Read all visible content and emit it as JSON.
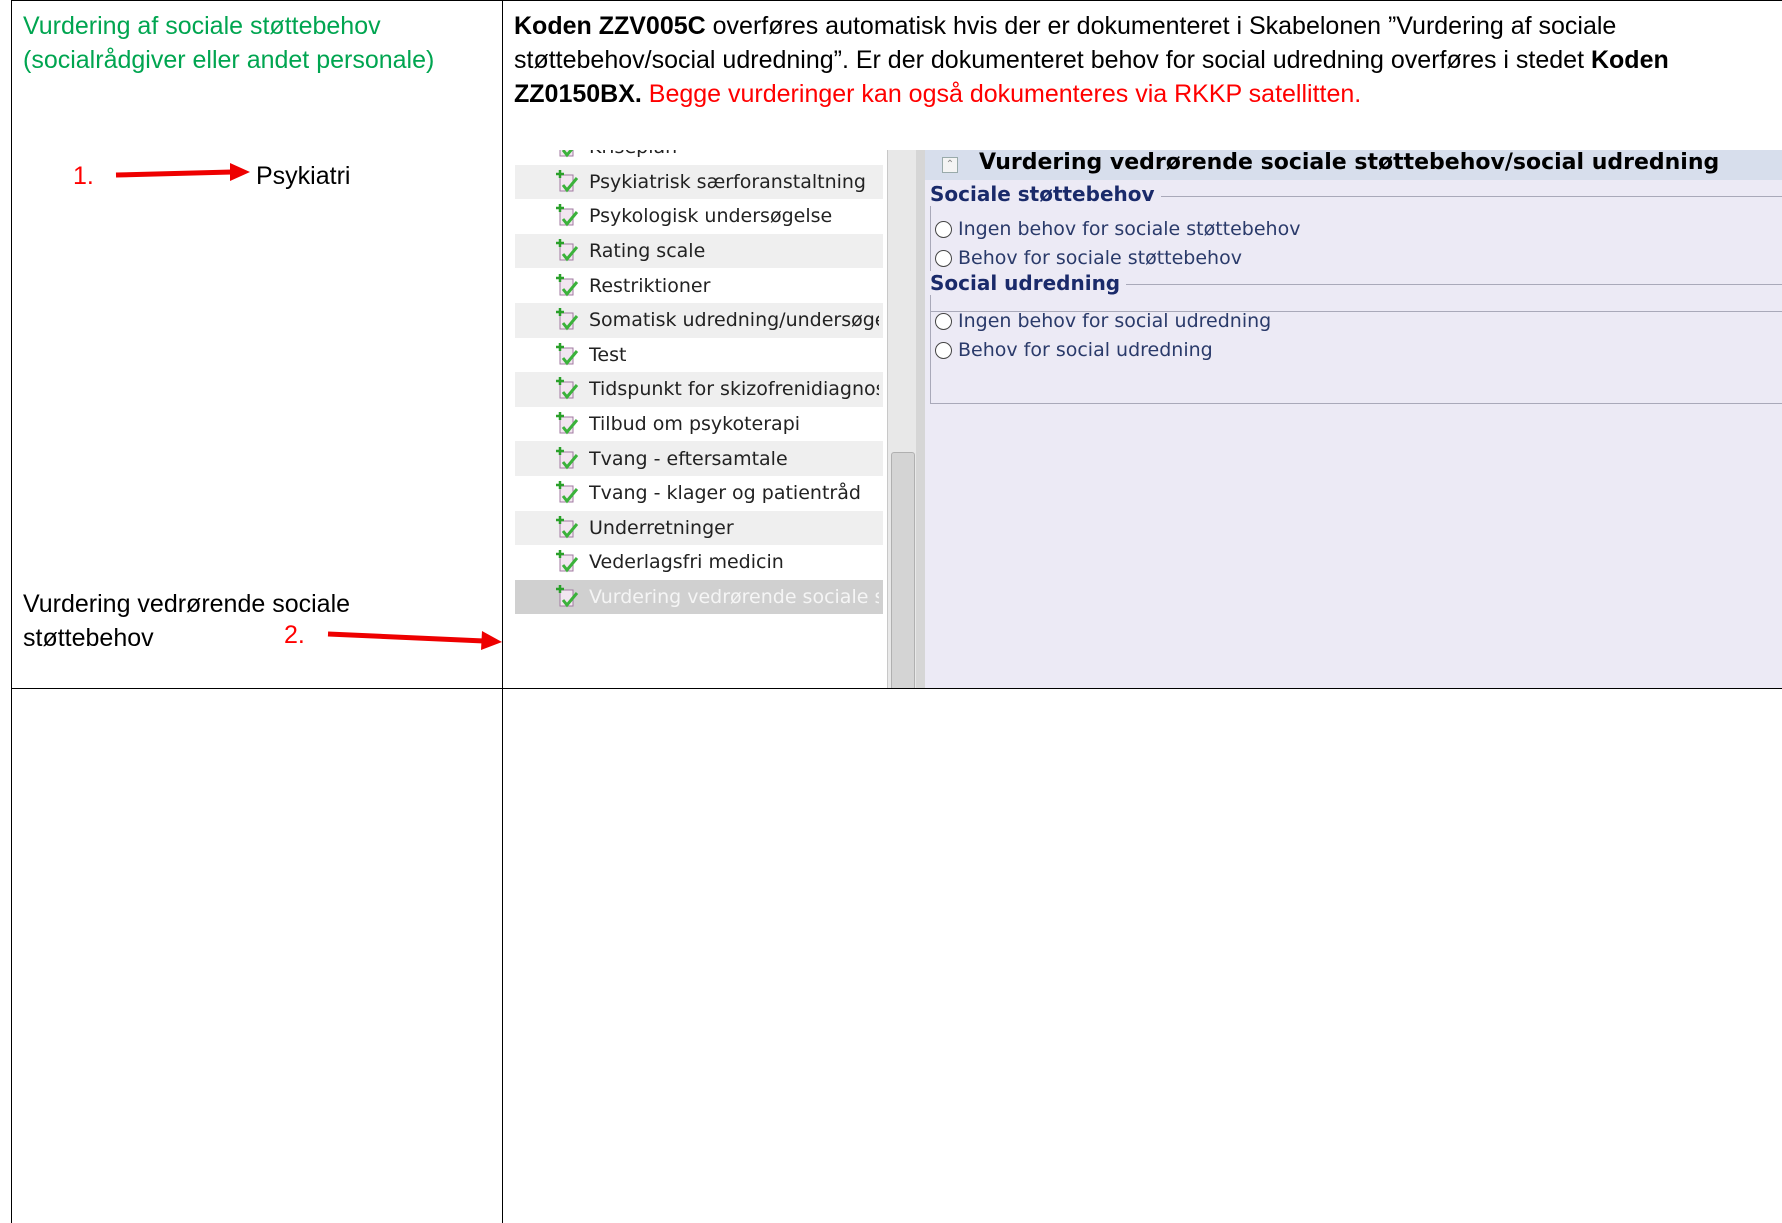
{
  "left_top": {
    "title_line1": "Vurdering af sociale støttebehov",
    "title_line2": "(socialrådgiver eller andet personale)",
    "step1_number": "1.",
    "step1_label": "Psykiatri",
    "step2_label_line1": "Vurdering vedrørende sociale",
    "step2_label_line2": "støttebehov",
    "step2_number": "2."
  },
  "instruction": {
    "code1": "Koden ZZV005C",
    "text1": " overføres automatisk hvis der er dokumenteret i Skabelonen ”Vurdering af sociale støttebehov/social udredning”. Er der dokumenteret behov for social udredning overføres i stedet ",
    "code2": "Koden ZZ0150BX.",
    "red_text": " Begge vurderinger kan også dokumenteres via RKKP satellitten."
  },
  "tree": {
    "items": [
      {
        "label": "Kriseplan"
      },
      {
        "label": "Psykiatrisk særforanstaltning"
      },
      {
        "label": "Psykologisk undersøgelse"
      },
      {
        "label": "Rating scale"
      },
      {
        "label": "Restriktioner"
      },
      {
        "label": "Somatisk udredning/undersøgelse"
      },
      {
        "label": "Test"
      },
      {
        "label": "Tidspunkt for skizofrenidiagnose"
      },
      {
        "label": "Tilbud om psykoterapi"
      },
      {
        "label": "Tvang - eftersamtale"
      },
      {
        "label": "Tvang - klager og patientråd"
      },
      {
        "label": "Underretninger"
      },
      {
        "label": "Vederlagsfri medicin"
      },
      {
        "label": "Vurdering vedrørende sociale støttebehov"
      }
    ],
    "selected_index": 13,
    "icon": "add-document-icon"
  },
  "panel": {
    "title": "Vurdering vedrørende sociale støttebehov/social udredning",
    "sections": [
      {
        "legend": "Sociale støttebehov",
        "options": [
          "Ingen behov for sociale støttebehov",
          "Behov for sociale støttebehov"
        ]
      },
      {
        "legend": "Social udredning",
        "options": [
          "Ingen behov for social udredning",
          "Behov for social udredning"
        ]
      }
    ]
  },
  "colors": {
    "green_title": "#00a550",
    "red": "#ff0000",
    "panel_bg": "#eceaf5",
    "legend": "#1a2a6a"
  }
}
